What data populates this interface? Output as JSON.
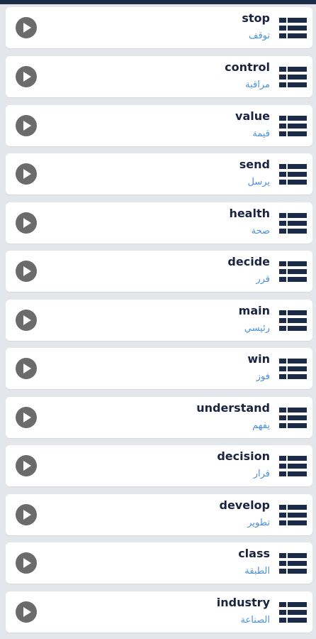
{
  "top_bar_color": "#1b2a47",
  "accent_color": "#1a2340",
  "translation_color": "#4a90d9",
  "icons": {
    "play": "play-circle-icon",
    "menu": "list-grid-icon"
  },
  "words": [
    {
      "en": "stop",
      "ar": "توقف"
    },
    {
      "en": "control",
      "ar": "مراقبة"
    },
    {
      "en": "value",
      "ar": "قيمة"
    },
    {
      "en": "send",
      "ar": "يرسل"
    },
    {
      "en": "health",
      "ar": "صحة"
    },
    {
      "en": "decide",
      "ar": "قرر"
    },
    {
      "en": "main",
      "ar": "رئيسي"
    },
    {
      "en": "win",
      "ar": "فوز"
    },
    {
      "en": "understand",
      "ar": "يفهم"
    },
    {
      "en": "decision",
      "ar": "قرار"
    },
    {
      "en": "develop",
      "ar": "تطوير"
    },
    {
      "en": "class",
      "ar": "الطبقة"
    },
    {
      "en": "industry",
      "ar": "الصناعة"
    }
  ]
}
